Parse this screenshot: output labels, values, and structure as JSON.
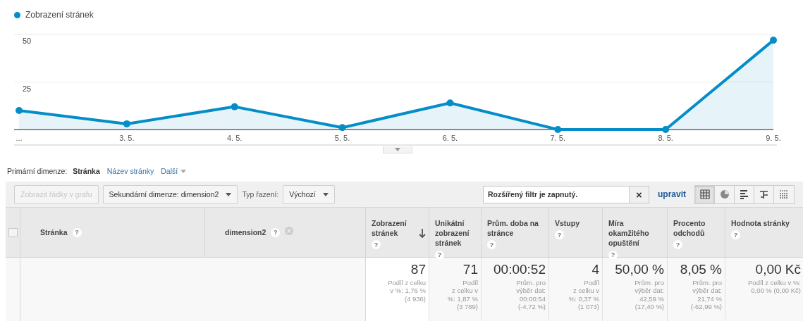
{
  "chart": {
    "chart_data": {
      "type": "area",
      "categories": [
        "...",
        "3. 5.",
        "4. 5.",
        "5. 5.",
        "6. 5.",
        "7. 5.",
        "8. 5.",
        "9. 5."
      ],
      "series": [
        {
          "name": "Zobrazení stránek",
          "color": "#058dc7",
          "values": [
            10,
            3,
            12,
            1,
            14,
            0,
            0,
            47
          ]
        }
      ],
      "ylim": [
        0,
        50
      ],
      "yticks": [
        25,
        50
      ]
    }
  },
  "primary_dimension": {
    "label": "Primární dimenze:",
    "options": [
      {
        "label": "Stránka",
        "selected": true,
        "kind": "link"
      },
      {
        "label": "Název stránky",
        "selected": false,
        "kind": "link"
      },
      {
        "label": "Další",
        "selected": false,
        "kind": "menu"
      }
    ]
  },
  "toolbar": {
    "plot_rows": {
      "label": "Zobrazit řádky v grafu",
      "disabled": true
    },
    "secondary_dimension": "Sekundární dimenze: dimension2",
    "sort_label": "Typ řazení:",
    "sort_value": "Výchozí",
    "filter": {
      "value": "Rozšířený filtr je zapnutý.",
      "clear": "×"
    },
    "edit_link": "upravit",
    "views": [
      {
        "kind": "table",
        "selected": true
      },
      {
        "kind": "pie",
        "selected": false
      },
      {
        "kind": "bars",
        "selected": false
      },
      {
        "kind": "pivot",
        "selected": false
      },
      {
        "kind": "lines",
        "selected": false
      }
    ]
  },
  "table": {
    "select_all": {
      "checked": false
    },
    "columns": [
      {
        "label": "Stránka",
        "kind": "dimension",
        "help": "?",
        "removable": false,
        "sorted": false
      },
      {
        "label": "dimension2",
        "kind": "dimension",
        "help": "?",
        "removable": true,
        "sorted": false
      },
      {
        "label": "Zobrazení stránek",
        "kind": "metric",
        "help": "?",
        "removable": false,
        "sorted": true
      },
      {
        "label": "Unikátní zobrazení stránek",
        "kind": "metric",
        "help": "?",
        "removable": false,
        "sorted": false
      },
      {
        "label": "Prům. doba na stránce",
        "kind": "metric",
        "help": "?",
        "removable": false,
        "sorted": false
      },
      {
        "label": "Vstupy",
        "kind": "metric",
        "help": "?",
        "removable": false,
        "sorted": false
      },
      {
        "label": "Míra okamžitého opuštění",
        "kind": "metric",
        "help": "?",
        "removable": false,
        "sorted": false
      },
      {
        "label": "Procento odchodů",
        "kind": "metric",
        "help": "?",
        "removable": false,
        "sorted": false
      },
      {
        "label": "Hodnota stránky",
        "kind": "metric",
        "help": "?",
        "removable": false,
        "sorted": false
      }
    ],
    "totals": [
      {
        "value": "87",
        "note": [
          "Podíl z celku",
          "v %: 1,76 %",
          "(4 936)"
        ]
      },
      {
        "value": "71",
        "note": [
          "Podíl",
          "z celku v",
          "%: 1,87 %",
          "(3 789)"
        ]
      },
      {
        "value": "00:00:52",
        "note": [
          "Prům. pro",
          "výběr dat:",
          "00:00:54",
          "(-4,72 %)"
        ]
      },
      {
        "value": "4",
        "note": [
          "Podíl",
          "z celku v",
          "%: 0,37 %",
          "(1 073)"
        ]
      },
      {
        "value": "50,00 %",
        "note": [
          "Prům. pro",
          "výběr dat:",
          "42,59 %",
          "(17,40 %)"
        ]
      },
      {
        "value": "8,05 %",
        "note": [
          "Prům. pro",
          "výběr dat:",
          "21,74 %",
          "(-62,99 %)"
        ]
      },
      {
        "value": "0,00 Kč",
        "note": [
          "Podíl z celku v %:",
          "0,00 % (0,00 Kč)"
        ]
      }
    ]
  }
}
